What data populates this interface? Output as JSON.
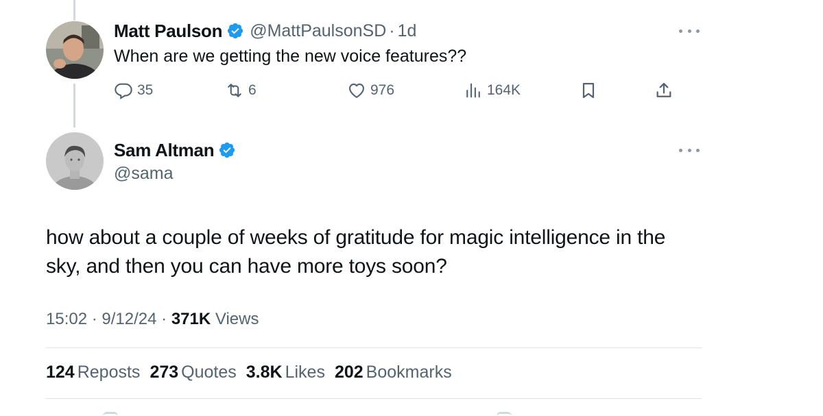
{
  "reply_tweet": {
    "author": {
      "display_name": "Matt Paulson",
      "handle": "@MattPaulsonSD",
      "verified": true,
      "avatar": "person-avatar"
    },
    "separator": "·",
    "age": "1d",
    "text": "When are we getting the new voice features??",
    "actions": {
      "replies": "35",
      "reposts": "6",
      "likes": "976",
      "views": "164K"
    }
  },
  "main_tweet": {
    "author": {
      "display_name": "Sam Altman",
      "handle": "@sama",
      "verified": true,
      "avatar": "person-avatar"
    },
    "text": "how about a couple of weeks of gratitude for magic intelligence in the sky, and then you can have more toys soon?",
    "meta": {
      "time": "15:02",
      "sep": "·",
      "date": "9/12/24",
      "views_count": "371K",
      "views_label": "Views"
    },
    "stats": [
      {
        "num": "124",
        "label": "Reposts"
      },
      {
        "num": "273",
        "label": "Quotes"
      },
      {
        "num": "3.8K",
        "label": "Likes"
      },
      {
        "num": "202",
        "label": "Bookmarks"
      }
    ]
  },
  "colors": {
    "text": "#0f1419",
    "secondary": "#536471",
    "verified": "#1d9bf0",
    "divider": "#dde3e7",
    "thread_line": "#cfd9de"
  },
  "icons": [
    "reply-icon",
    "repost-icon",
    "like-icon",
    "views-icon",
    "bookmark-icon",
    "share-icon",
    "verified-badge-icon",
    "more-options-icon"
  ]
}
